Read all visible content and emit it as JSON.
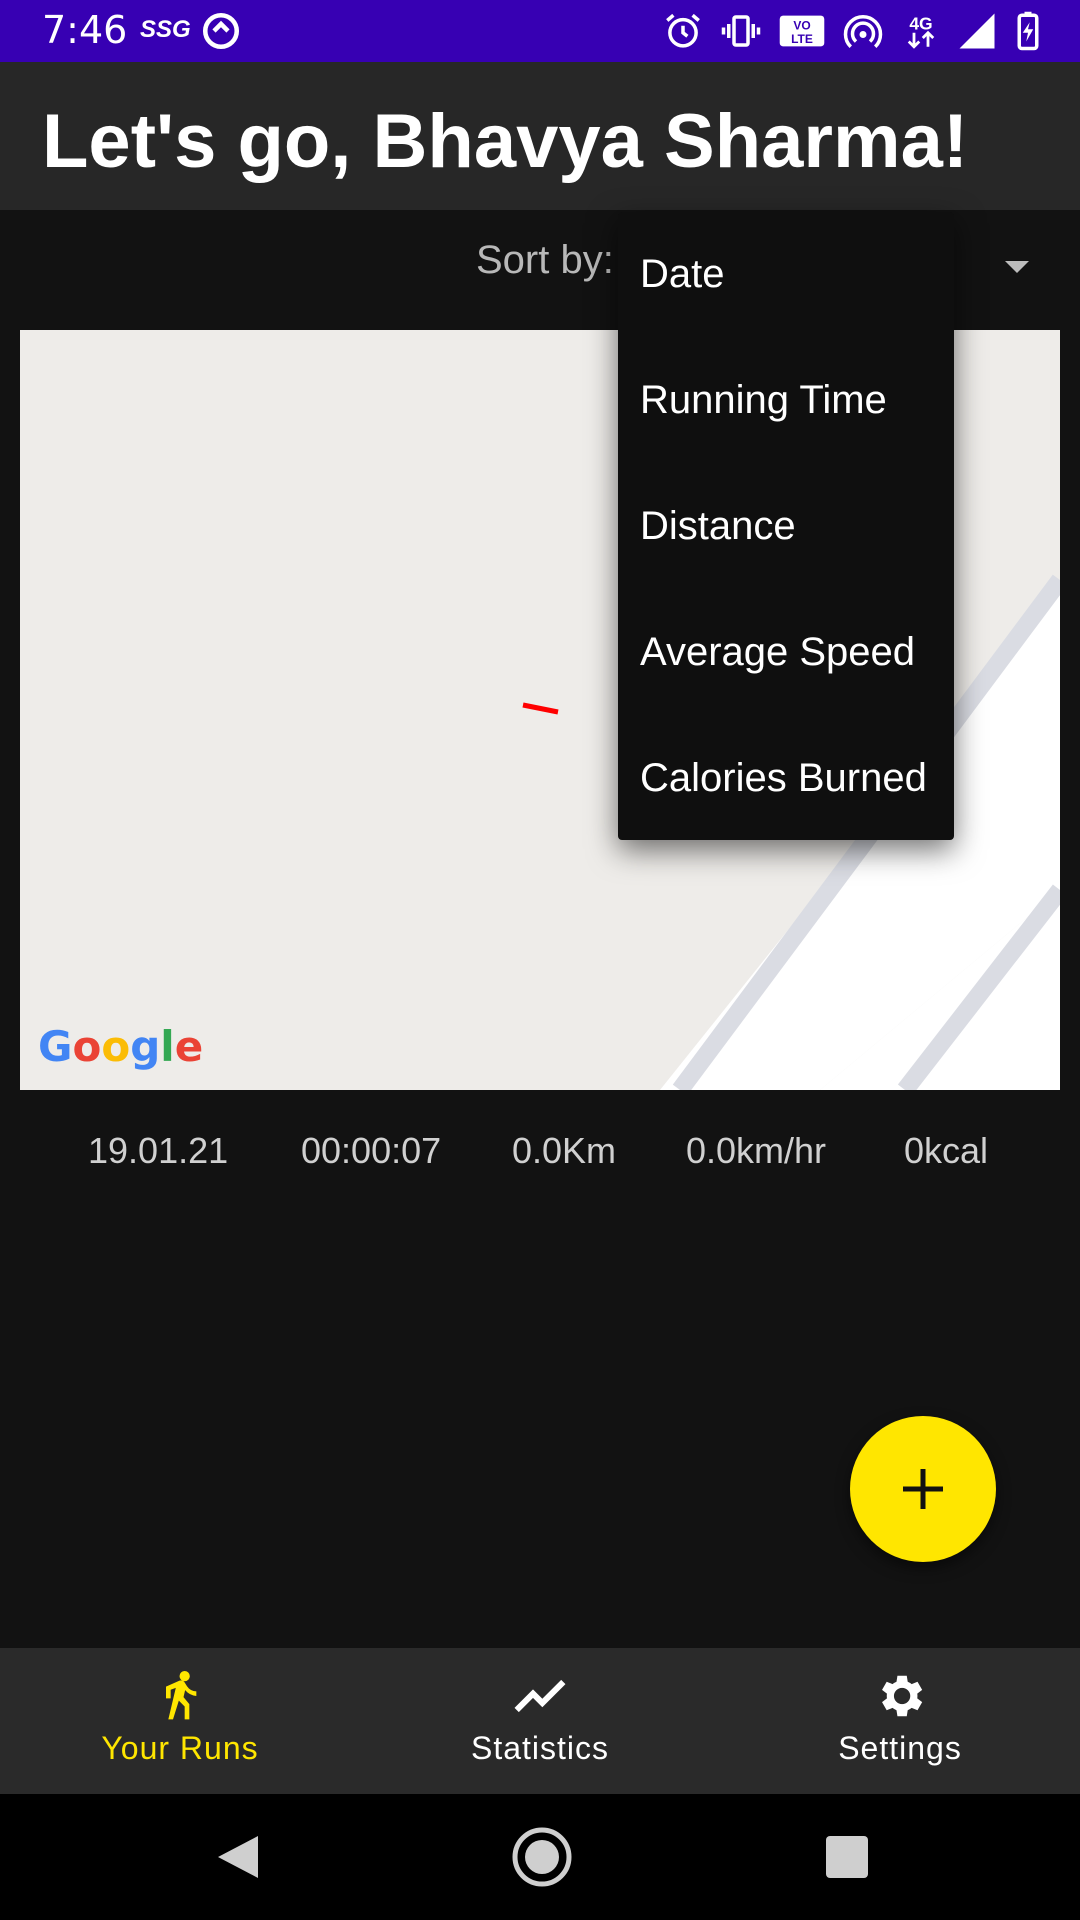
{
  "status_bar": {
    "time": "7:46",
    "carrier": "SSG",
    "background_color": "#3700b3",
    "icons": [
      "alarm-icon",
      "vibrate-icon",
      "volte-icon",
      "hotspot-icon",
      "4g-icon",
      "signal-icon",
      "battery-charging-icon"
    ],
    "volte_label": "VO\nLTE",
    "network_label": "4G"
  },
  "app_bar": {
    "title": "Let's go, Bhavya Sharma!"
  },
  "sort": {
    "label": "Sort by:",
    "selected": "Date",
    "options": [
      "Date",
      "Running Time",
      "Distance",
      "Average Speed",
      "Calories Burned"
    ]
  },
  "run": {
    "map_attribution": "Google",
    "date": "19.01.21",
    "time": "00:00:07",
    "distance": "0.0Km",
    "speed": "0.0km/hr",
    "calories": "0kcal",
    "route_color": "#ff0000"
  },
  "fab": {
    "icon": "plus-icon",
    "color": "#ffe600"
  },
  "bottom_nav": {
    "items": [
      {
        "label": "Your Runs",
        "icon": "running-person-icon",
        "active": true
      },
      {
        "label": "Statistics",
        "icon": "trending-line-icon",
        "active": false
      },
      {
        "label": "Settings",
        "icon": "gear-icon",
        "active": false
      }
    ],
    "active_color": "#ffe600",
    "inactive_color": "#ffffff"
  },
  "system_nav": {
    "icons": [
      "back-icon",
      "home-icon",
      "recents-icon"
    ]
  }
}
